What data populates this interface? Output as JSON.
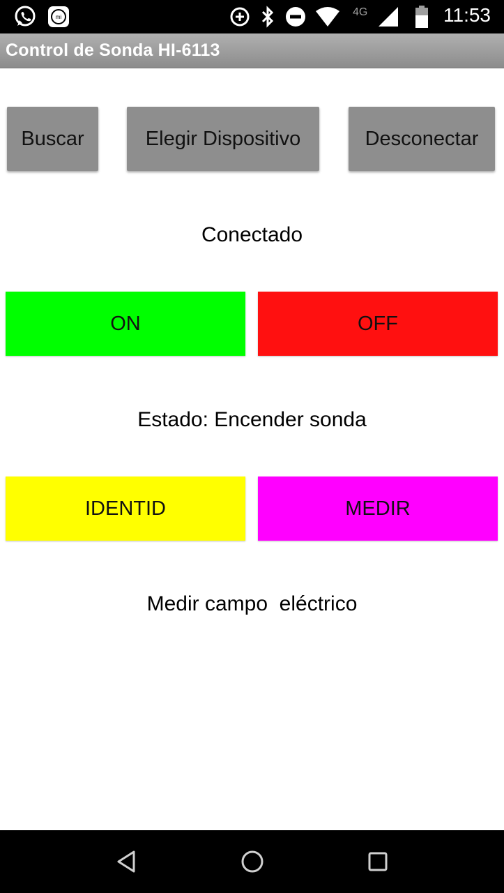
{
  "status_bar": {
    "network_type": "4G",
    "time": "11:53",
    "icons": [
      "whatsapp-icon",
      "mi-icon",
      "data-saver-icon",
      "bluetooth-icon",
      "do-not-disturb-icon",
      "wifi-icon",
      "cell-signal-icon",
      "battery-icon"
    ]
  },
  "app": {
    "title": "Control de Sonda HI-6113"
  },
  "connection": {
    "search_label": "Buscar",
    "choose_device_label": "Elegir Dispositivo",
    "disconnect_label": "Desconectar",
    "status_text": "Conectado"
  },
  "power": {
    "on_label": "ON",
    "off_label": "OFF",
    "on_color": "#00ff00",
    "off_color": "#ff1010",
    "state_text": "Estado: Encender sonda"
  },
  "measure": {
    "identify_label": "IDENTID",
    "measure_label": "MEDIR",
    "identify_color": "#ffff00",
    "measure_color": "#ff00ff",
    "status_text": "Medir campo  eléctrico"
  },
  "nav_bar": {
    "buttons": [
      "back-icon",
      "home-icon",
      "recents-icon"
    ]
  }
}
